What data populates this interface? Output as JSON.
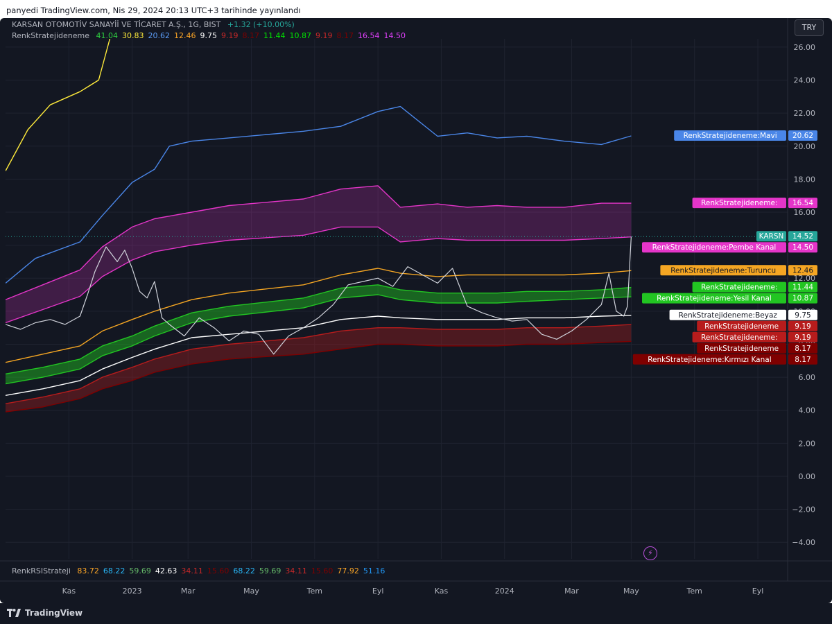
{
  "header": {
    "publish_text": "panyedi TradingView.com, Nis 29, 2024 20:13 UTC+3 tarihinde yayınlandı"
  },
  "symbol_legend": {
    "title": "KARSAN OTOMOTİV SANAYİİ VE TİCARET A.Ş., 1G, BIST",
    "change": "+1.32 (+10.00%)",
    "change_color": "#26a69a"
  },
  "indicator_legend": {
    "name": "RenkStratejideneme",
    "values": [
      {
        "text": "41.04",
        "color": "#2ecc40"
      },
      {
        "text": "30.83",
        "color": "#ffeb3b"
      },
      {
        "text": "20.62",
        "color": "#5b9cf6"
      },
      {
        "text": "12.46",
        "color": "#ffa726"
      },
      {
        "text": "9.75",
        "color": "#ffffff"
      },
      {
        "text": "9.19",
        "color": "#c62828"
      },
      {
        "text": "8.17",
        "color": "#7f0000"
      },
      {
        "text": "11.44",
        "color": "#00e600"
      },
      {
        "text": "10.87",
        "color": "#00e600"
      },
      {
        "text": "9.19",
        "color": "#c62828"
      },
      {
        "text": "8.17",
        "color": "#7f0000"
      },
      {
        "text": "16.54",
        "color": "#e040fb"
      },
      {
        "text": "14.50",
        "color": "#e040fb"
      }
    ]
  },
  "rsi_legend": {
    "name": "RenkRSIStrateji",
    "values": [
      {
        "text": "83.72",
        "color": "#ffa726"
      },
      {
        "text": "68.22",
        "color": "#29b6f6"
      },
      {
        "text": "59.69",
        "color": "#66bb6a"
      },
      {
        "text": "42.63",
        "color": "#ffffff"
      },
      {
        "text": "34.11",
        "color": "#c62828"
      },
      {
        "text": "15.60",
        "color": "#7f0000"
      },
      {
        "text": "68.22",
        "color": "#29b6f6"
      },
      {
        "text": "59.69",
        "color": "#66bb6a"
      },
      {
        "text": "34.11",
        "color": "#c62828"
      },
      {
        "text": "15.60",
        "color": "#7f0000"
      },
      {
        "text": "77.92",
        "color": "#ffa726"
      },
      {
        "text": "51.16",
        "color": "#2196f3"
      }
    ]
  },
  "currency": "TRY",
  "brand": "TradingView",
  "price_labels": [
    {
      "label": "RenkStratejideneme:Mavi",
      "value": "20.62",
      "price": 20.62,
      "color": "#4a86e8",
      "text_color": "#ffffff"
    },
    {
      "label": "RenkStratejideneme:",
      "value": "16.54",
      "price": 16.54,
      "color": "#e535c9",
      "text_color": "#ffffff"
    },
    {
      "label": "KARSN",
      "value": "14.52",
      "price": 14.52,
      "color": "#26a69a",
      "text_color": "#ffffff"
    },
    {
      "label": "RenkStratejideneme:Pembe Kanal",
      "value": "14.50",
      "price": 14.5,
      "color": "#e535c9",
      "text_color": "#ffffff"
    },
    {
      "label": "RenkStratejideneme:Turuncu",
      "value": "12.46",
      "price": 12.46,
      "color": "#f5a623",
      "text_color": "#131722"
    },
    {
      "label": "RenkStratejideneme:",
      "value": "11.44",
      "price": 11.44,
      "color": "#22c522",
      "text_color": "#ffffff"
    },
    {
      "label": "RenkStratejideneme:Yesil Kanal",
      "value": "10.87",
      "price": 10.87,
      "color": "#22c522",
      "text_color": "#ffffff"
    },
    {
      "label": "RenkStratejideneme:Beyaz",
      "value": "9.75",
      "price": 9.75,
      "color": "#ffffff",
      "text_color": "#131722"
    },
    {
      "label": "RenkStratejideneme",
      "value": "9.19",
      "price": 9.19,
      "color": "#b71c1c",
      "text_color": "#ffffff"
    },
    {
      "label": "RenkStratejideneme:",
      "value": "9.19",
      "price": 9.19,
      "color": "#b71c1c",
      "text_color": "#ffffff"
    },
    {
      "label": "RenkStratejideneme",
      "value": "8.17",
      "price": 8.17,
      "color": "#7f0000",
      "text_color": "#ffffff"
    },
    {
      "label": "RenkStratejideneme:Kırmızı Kanal",
      "value": "8.17",
      "price": 8.17,
      "color": "#7f0000",
      "text_color": "#ffffff"
    }
  ],
  "chart_data": {
    "type": "line",
    "symbol": "KARSN",
    "interval": "1G",
    "y_axis_ticks": [
      "26.00",
      "24.00",
      "22.00",
      "20.00",
      "18.00",
      "16.00",
      "14.00",
      "12.00",
      "10.00",
      "8.00",
      "6.00",
      "4.00",
      "2.00",
      "0.00",
      "−2.00",
      "−4.00"
    ],
    "ylim": [
      -5,
      26.5
    ],
    "x_axis_ticks": [
      {
        "label": "Kas",
        "t": 0.085
      },
      {
        "label": "2023",
        "t": 0.17
      },
      {
        "label": "Mar",
        "t": 0.245
      },
      {
        "label": "May",
        "t": 0.33
      },
      {
        "label": "Tem",
        "t": 0.415
      },
      {
        "label": "Eyl",
        "t": 0.5
      },
      {
        "label": "Kas",
        "t": 0.585
      },
      {
        "label": "2024",
        "t": 0.67
      },
      {
        "label": "Mar",
        "t": 0.76
      },
      {
        "label": "May",
        "t": 0.84
      },
      {
        "label": "Tem",
        "t": 0.925
      },
      {
        "label": "Eyl",
        "t": 1.01
      }
    ],
    "xlim": [
      0,
      1.05
    ],
    "series": [
      {
        "name": "Sarı",
        "color": "#ffeb3b",
        "t": [
          0,
          0.03,
          0.06,
          0.1,
          0.125,
          0.14,
          0.155
        ],
        "y": [
          18.5,
          21.0,
          22.5,
          23.3,
          24.0,
          26.5,
          28.5
        ]
      },
      {
        "name": "Mavi",
        "color": "#4a86e8",
        "t": [
          0,
          0.04,
          0.1,
          0.13,
          0.17,
          0.2,
          0.22,
          0.25,
          0.3,
          0.4,
          0.45,
          0.5,
          0.53,
          0.58,
          0.62,
          0.66,
          0.7,
          0.75,
          0.8,
          0.84
        ],
        "y": [
          11.7,
          13.2,
          14.2,
          15.8,
          17.8,
          18.6,
          20.0,
          20.3,
          20.5,
          20.9,
          21.2,
          22.1,
          22.4,
          20.6,
          20.8,
          20.5,
          20.6,
          20.3,
          20.1,
          20.62
        ]
      },
      {
        "name": "Pembe üst",
        "color": "#e535c9",
        "t": [
          0,
          0.05,
          0.1,
          0.13,
          0.17,
          0.2,
          0.25,
          0.3,
          0.4,
          0.45,
          0.5,
          0.53,
          0.58,
          0.62,
          0.66,
          0.7,
          0.75,
          0.8,
          0.84
        ],
        "y": [
          10.7,
          11.6,
          12.5,
          13.9,
          15.1,
          15.6,
          16.0,
          16.4,
          16.8,
          17.4,
          17.6,
          16.3,
          16.5,
          16.3,
          16.4,
          16.3,
          16.3,
          16.54,
          16.54
        ]
      },
      {
        "name": "Pembe Kanal",
        "color": "#e535c9",
        "t": [
          0,
          0.05,
          0.1,
          0.13,
          0.17,
          0.2,
          0.25,
          0.3,
          0.4,
          0.45,
          0.5,
          0.53,
          0.58,
          0.62,
          0.66,
          0.7,
          0.75,
          0.8,
          0.84
        ],
        "y": [
          9.3,
          10.1,
          10.9,
          12.1,
          13.1,
          13.6,
          14.0,
          14.3,
          14.6,
          15.1,
          15.1,
          14.2,
          14.4,
          14.3,
          14.3,
          14.3,
          14.3,
          14.4,
          14.5
        ]
      },
      {
        "name": "Turuncu",
        "color": "#f5a623",
        "t": [
          0,
          0.05,
          0.1,
          0.13,
          0.17,
          0.2,
          0.25,
          0.3,
          0.4,
          0.45,
          0.5,
          0.53,
          0.58,
          0.62,
          0.66,
          0.7,
          0.75,
          0.8,
          0.84
        ],
        "y": [
          6.9,
          7.4,
          7.9,
          8.8,
          9.5,
          10.0,
          10.7,
          11.1,
          11.6,
          12.2,
          12.6,
          12.3,
          12.1,
          12.2,
          12.2,
          12.2,
          12.2,
          12.3,
          12.46
        ]
      },
      {
        "name": "Yeşil üst",
        "color": "#22c522",
        "t": [
          0,
          0.05,
          0.1,
          0.13,
          0.17,
          0.2,
          0.25,
          0.3,
          0.4,
          0.45,
          0.5,
          0.53,
          0.58,
          0.62,
          0.66,
          0.7,
          0.75,
          0.8,
          0.84
        ],
        "y": [
          6.2,
          6.6,
          7.1,
          7.9,
          8.5,
          9.1,
          9.9,
          10.3,
          10.8,
          11.4,
          11.6,
          11.3,
          11.1,
          11.1,
          11.1,
          11.2,
          11.2,
          11.3,
          11.44
        ]
      },
      {
        "name": "Yeşil Kanal",
        "color": "#22c522",
        "t": [
          0,
          0.05,
          0.1,
          0.13,
          0.17,
          0.2,
          0.25,
          0.3,
          0.4,
          0.45,
          0.5,
          0.53,
          0.58,
          0.62,
          0.66,
          0.7,
          0.75,
          0.8,
          0.84
        ],
        "y": [
          5.6,
          6.0,
          6.5,
          7.3,
          7.9,
          8.5,
          9.3,
          9.7,
          10.2,
          10.8,
          11.0,
          10.7,
          10.5,
          10.5,
          10.5,
          10.6,
          10.7,
          10.8,
          10.87
        ]
      },
      {
        "name": "Beyaz",
        "color": "#ffffff",
        "t": [
          0,
          0.05,
          0.1,
          0.13,
          0.17,
          0.2,
          0.25,
          0.3,
          0.4,
          0.45,
          0.5,
          0.53,
          0.58,
          0.62,
          0.66,
          0.7,
          0.75,
          0.8,
          0.84
        ],
        "y": [
          4.9,
          5.3,
          5.8,
          6.5,
          7.2,
          7.7,
          8.4,
          8.6,
          9.0,
          9.5,
          9.7,
          9.6,
          9.5,
          9.5,
          9.5,
          9.6,
          9.6,
          9.7,
          9.75
        ]
      },
      {
        "name": "Kırmızı üst",
        "color": "#b71c1c",
        "t": [
          0,
          0.05,
          0.1,
          0.13,
          0.17,
          0.2,
          0.25,
          0.3,
          0.4,
          0.45,
          0.5,
          0.53,
          0.58,
          0.62,
          0.66,
          0.7,
          0.75,
          0.8,
          0.84
        ],
        "y": [
          4.4,
          4.8,
          5.3,
          6.0,
          6.6,
          7.1,
          7.7,
          8.0,
          8.4,
          8.8,
          9.0,
          9.0,
          8.9,
          8.9,
          8.9,
          9.0,
          9.0,
          9.1,
          9.19
        ]
      },
      {
        "name": "Kırmızı Kanal",
        "color": "#7f0000",
        "t": [
          0,
          0.05,
          0.1,
          0.13,
          0.17,
          0.2,
          0.25,
          0.3,
          0.4,
          0.45,
          0.5,
          0.53,
          0.58,
          0.62,
          0.66,
          0.7,
          0.75,
          0.8,
          0.84
        ],
        "y": [
          3.9,
          4.2,
          4.7,
          5.3,
          5.8,
          6.3,
          6.8,
          7.1,
          7.4,
          7.7,
          8.0,
          8.0,
          7.9,
          7.9,
          7.9,
          8.0,
          8.0,
          8.1,
          8.17
        ]
      },
      {
        "name": "KARSN",
        "color": "#d1d4dc",
        "t": [
          0,
          0.02,
          0.04,
          0.06,
          0.08,
          0.1,
          0.11,
          0.12,
          0.135,
          0.15,
          0.16,
          0.17,
          0.18,
          0.19,
          0.2,
          0.21,
          0.22,
          0.24,
          0.26,
          0.28,
          0.3,
          0.32,
          0.34,
          0.36,
          0.38,
          0.4,
          0.42,
          0.44,
          0.46,
          0.48,
          0.5,
          0.52,
          0.54,
          0.56,
          0.58,
          0.6,
          0.62,
          0.64,
          0.66,
          0.68,
          0.7,
          0.72,
          0.74,
          0.76,
          0.78,
          0.8,
          0.81,
          0.82,
          0.83,
          0.835,
          0.84
        ],
        "y": [
          9.2,
          8.9,
          9.3,
          9.5,
          9.2,
          9.7,
          11.0,
          12.4,
          13.9,
          13.0,
          13.7,
          12.6,
          11.2,
          10.8,
          11.8,
          9.6,
          9.2,
          8.5,
          9.6,
          9.0,
          8.2,
          8.8,
          8.6,
          7.4,
          8.5,
          9.0,
          9.6,
          10.4,
          11.6,
          11.8,
          12.0,
          11.5,
          12.7,
          12.2,
          11.7,
          12.6,
          10.3,
          9.9,
          9.6,
          9.4,
          9.5,
          8.6,
          8.3,
          8.8,
          9.5,
          10.4,
          12.3,
          10.0,
          9.7,
          10.3,
          14.52
        ]
      }
    ],
    "fills": [
      {
        "upper": "Pembe üst",
        "lower": "Pembe Kanal",
        "color": "rgba(229,53,201,0.22)"
      },
      {
        "upper": "Yeşil üst",
        "lower": "Yeşil Kanal",
        "color": "rgba(34,197,34,0.45)"
      },
      {
        "upper": "Kırmızı üst",
        "lower": "Kırmızı Kanal",
        "color": "rgba(183,28,28,0.35)"
      }
    ]
  }
}
